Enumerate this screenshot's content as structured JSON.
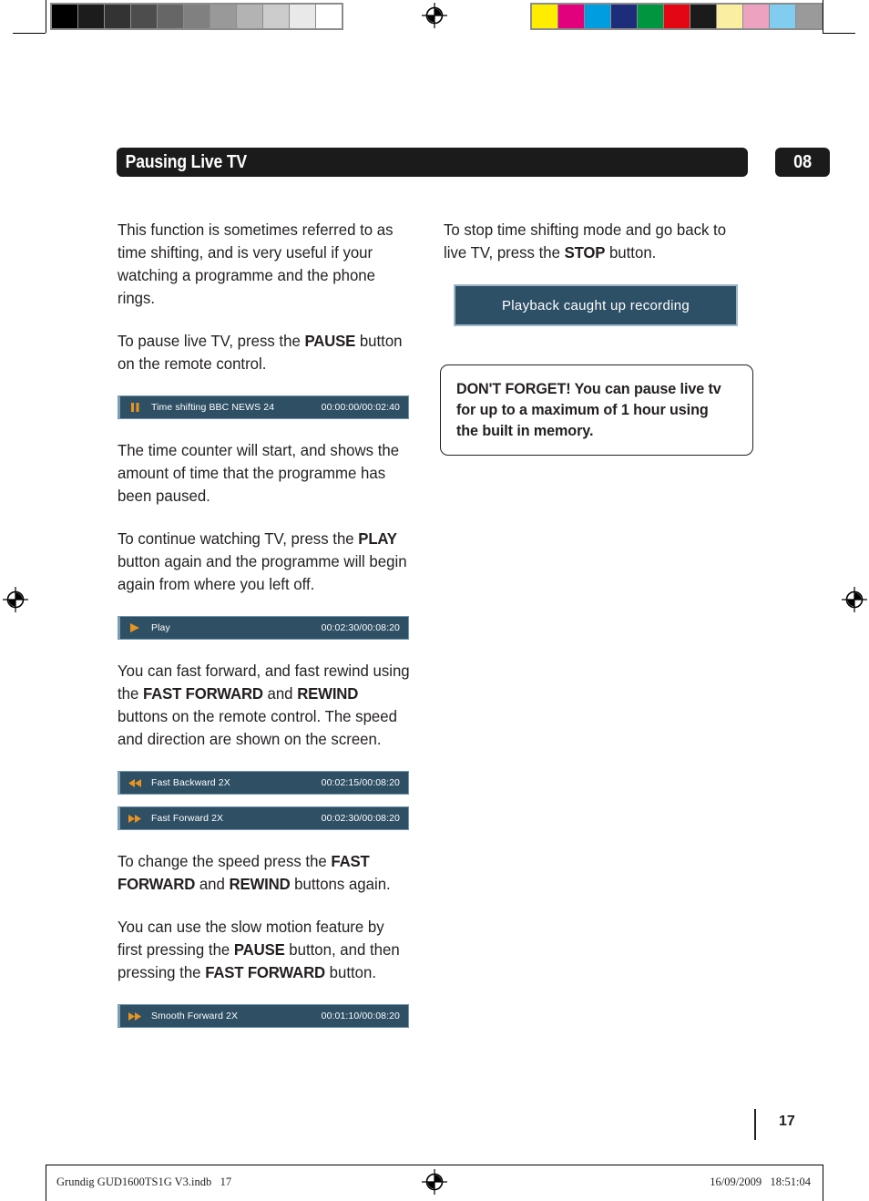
{
  "print_marks": {
    "gray_swatches": [
      "#000000",
      "#1c1c1c",
      "#333333",
      "#4d4d4d",
      "#666666",
      "#808080",
      "#999999",
      "#b3b3b3",
      "#cccccc",
      "#e9e9e9",
      "#ffffff"
    ],
    "color_swatches": [
      "#ffed00",
      "#e2007d",
      "#009ee0",
      "#1d2d7a",
      "#009640",
      "#e30613",
      "#1b1b1b",
      "#faeea0",
      "#eda2c0",
      "#80cdf0",
      "#9a9a9a"
    ],
    "registration_icon": "registration-target-icon"
  },
  "header": {
    "title": "Pausing Live TV",
    "chapter_number": "08"
  },
  "left_column": {
    "paragraph_1": "This function is sometimes referred to as time shifting, and is very useful if your watching a programme and the phone rings.",
    "paragraph_2_pre": "To pause live TV, press the ",
    "paragraph_2_bold": "PAUSE",
    "paragraph_2_post": " button on the remote control.",
    "paragraph_3": "The time counter will start, and shows the amount of time that the programme has been paused.",
    "paragraph_4_pre": "To continue watching TV, press the ",
    "paragraph_4_bold": "PLAY",
    "paragraph_4_post": " button again and the programme will begin again from where you left off.",
    "paragraph_5_pre": "You can fast forward, and fast rewind using the ",
    "paragraph_5_bold_1": "FAST FORWARD",
    "paragraph_5_mid": " and ",
    "paragraph_5_bold_2": "REWIND",
    "paragraph_5_post": " buttons on the remote control. The speed and direction are shown on the screen.",
    "paragraph_6_pre": "To change the speed press the ",
    "paragraph_6_bold_1": "FAST FORWARD",
    "paragraph_6_mid": " and ",
    "paragraph_6_bold_2": "REWIND",
    "paragraph_6_post": " buttons again.",
    "paragraph_7_pre": "You can use the slow motion feature by first pressing the ",
    "paragraph_7_bold_1": "PAUSE",
    "paragraph_7_mid": " button, and then pressing the ",
    "paragraph_7_bold_2": "FAST FORWARD",
    "paragraph_7_post": " button."
  },
  "osd_bars": [
    {
      "icon": "pause-icon",
      "label": "Time shifting BBC NEWS 24",
      "time": "00:00:00/00:02:40"
    },
    {
      "icon": "play-icon",
      "label": "Play",
      "time": "00:02:30/00:08:20"
    },
    {
      "icon": "fast-backward-icon",
      "label": "Fast Backward 2X",
      "time": "00:02:15/00:08:20"
    },
    {
      "icon": "fast-forward-icon",
      "label": "Fast Forward 2X",
      "time": "00:02:30/00:08:20"
    },
    {
      "icon": "fast-forward-icon",
      "label": "Smooth Forward 2X",
      "time": "00:01:10/00:08:20"
    }
  ],
  "right_column": {
    "paragraph_1_pre": "To stop time shifting mode and go back to live TV, press the ",
    "paragraph_1_bold": "STOP",
    "paragraph_1_post": " button.",
    "playback_dialog_text": "Playback caught up recording",
    "dont_forget_text": "DON'T FORGET! You can pause live tv for up to a maximum of 1 hour using the built in memory."
  },
  "footer": {
    "page_number": "17",
    "file_name": "Grundig GUD1600TS1G V3.indb   17",
    "timestamp": "16/09/2009   18:51:04"
  },
  "colors": {
    "header_bar": "#1b1b1b",
    "osd_background": "#2e4f64",
    "osd_border": "#7d9fb5",
    "osd_icon": "#e8941f",
    "dialog_background": "#2e5066",
    "text": "#231f20"
  }
}
